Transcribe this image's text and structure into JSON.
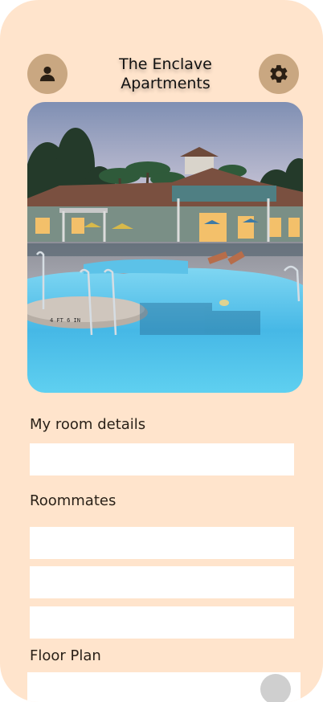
{
  "header": {
    "title_line1": "The Enclave",
    "title_line2": "Apartments",
    "profile_icon": "person-icon",
    "settings_icon": "gear-icon"
  },
  "hero": {
    "image": "apartment-pool-at-dusk",
    "depth_marker": "4 FT 6 IN"
  },
  "sections": {
    "room_details_label": "My room details",
    "roommates_label": "Roommates",
    "floor_plan_label": "Floor Plan"
  },
  "colors": {
    "background": "#ffe4cc",
    "button": "#c9a781",
    "field": "#ffffff",
    "fab": "#cfcfcf"
  }
}
